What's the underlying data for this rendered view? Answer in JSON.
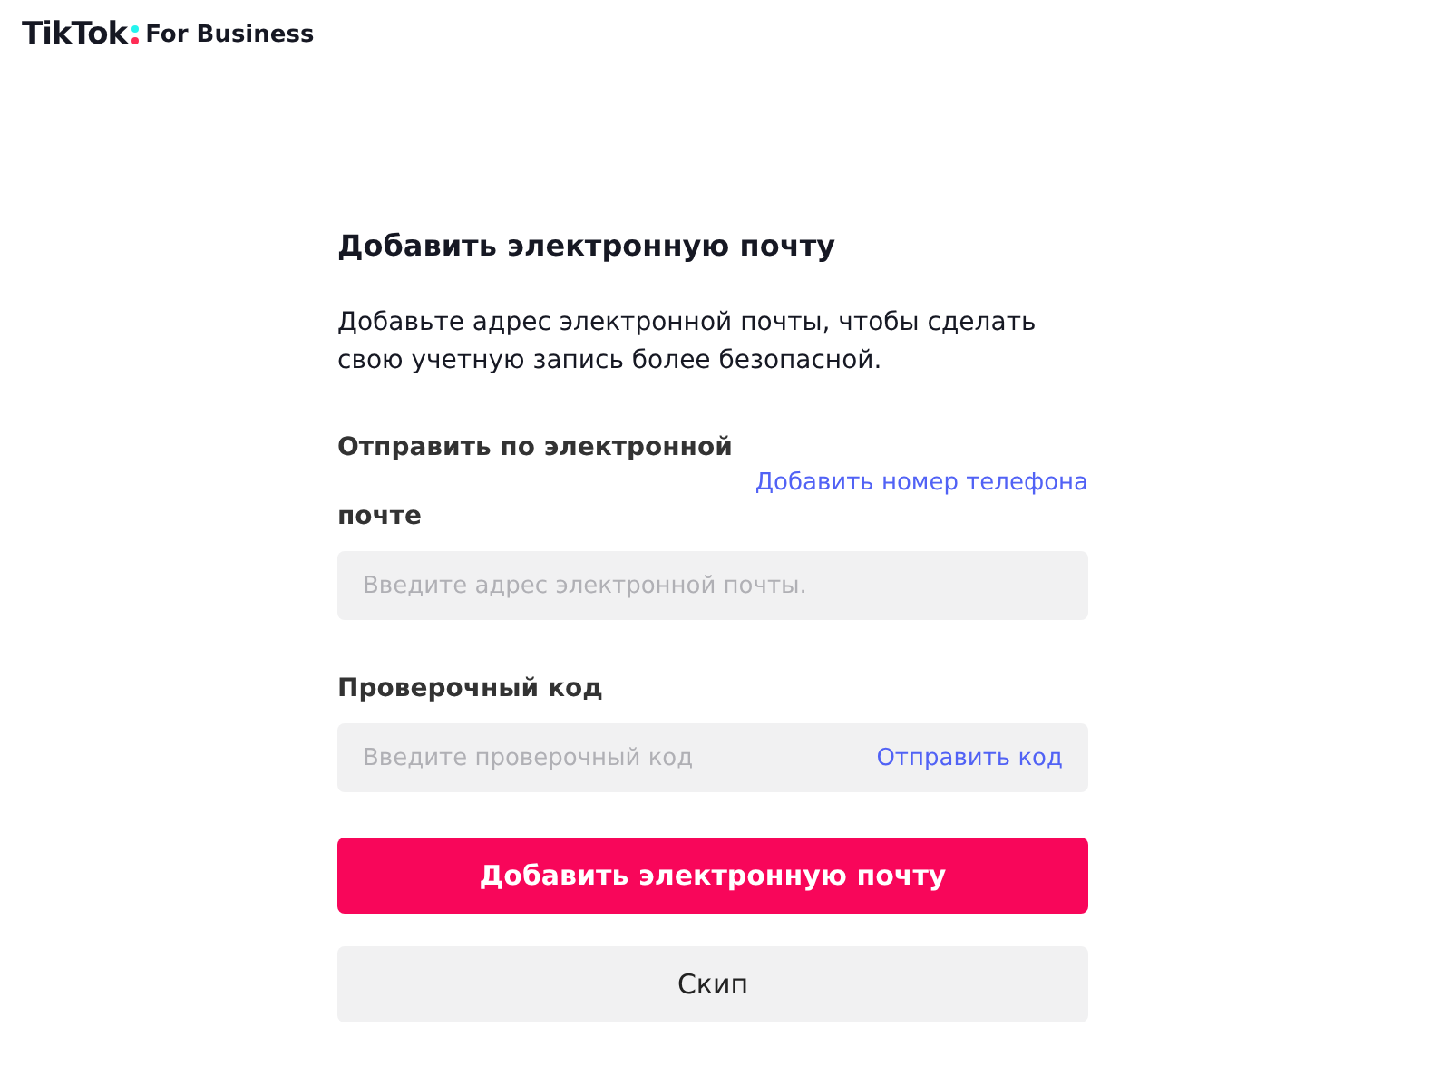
{
  "header": {
    "logo": {
      "brand": "TikTok",
      "suffix": "For Business"
    }
  },
  "form": {
    "title": "Добавить электронную почту",
    "description": "Добавьте адрес электронной почты, чтобы сделать свою учетную запись более безопасной.",
    "email_label": "Отправить по электронной почте",
    "phone_link": "Добавить номер телефона",
    "email_field": {
      "placeholder": "Введите адрес электронной почты."
    },
    "code_label": "Проверочный код",
    "code_field": {
      "placeholder": "Введите проверочный код"
    },
    "send_code": "Отправить код",
    "submit": "Добавить электронную почту",
    "skip": "Скип"
  }
}
